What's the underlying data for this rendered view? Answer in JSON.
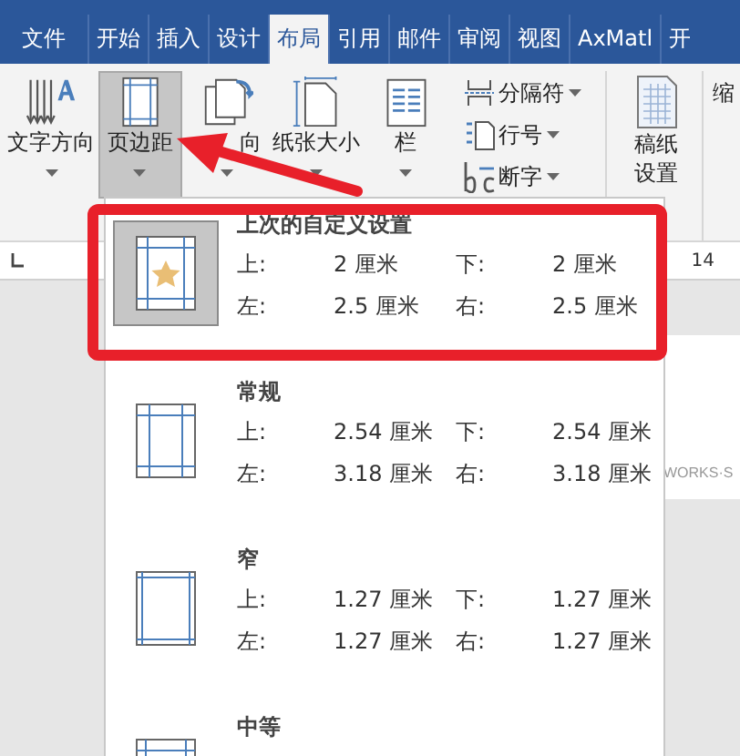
{
  "tabs": [
    {
      "label": "文件",
      "selected": false
    },
    {
      "label": "开始",
      "selected": false
    },
    {
      "label": "插入",
      "selected": false
    },
    {
      "label": "设计",
      "selected": false
    },
    {
      "label": "布局",
      "selected": true
    },
    {
      "label": "引用",
      "selected": false
    },
    {
      "label": "邮件",
      "selected": false
    },
    {
      "label": "审阅",
      "selected": false
    },
    {
      "label": "视图",
      "selected": false
    },
    {
      "label": "AxMatl",
      "selected": false
    },
    {
      "label": "开",
      "selected": false
    }
  ],
  "ribbon": {
    "large_buttons": [
      {
        "kind": "text-direction",
        "label": "文字方向",
        "selected": false
      },
      {
        "kind": "margins",
        "label": "页边距",
        "selected": true
      },
      {
        "kind": "orientation",
        "label": "向",
        "selected": false
      },
      {
        "kind": "size",
        "label": "纸张大小",
        "selected": false
      },
      {
        "kind": "columns",
        "label": "栏",
        "selected": false
      }
    ],
    "small_buttons": [
      {
        "kind": "breaks",
        "label": "分隔符"
      },
      {
        "kind": "line-numbers",
        "label": "行号"
      },
      {
        "kind": "hyphenation",
        "label": "断字"
      }
    ],
    "draft_button": {
      "lines": [
        "稿纸",
        "设置"
      ]
    },
    "next_group_label": "缩"
  },
  "ruler": {
    "number": "14"
  },
  "document_text": "WORKS·S",
  "margins_menu": {
    "items": [
      {
        "kind": "custom",
        "title": "上次的自定义设置",
        "selected": true,
        "rows": [
          {
            "label": "上:",
            "value": "2 厘米",
            "label2": "下:",
            "value2": "2 厘米"
          },
          {
            "label": "左:",
            "value": "2.5 厘米",
            "label2": "右:",
            "value2": "2.5 厘米"
          }
        ]
      },
      {
        "kind": "normal",
        "title": "常规",
        "selected": false,
        "rows": [
          {
            "label": "上:",
            "value": "2.54 厘米",
            "label2": "下:",
            "value2": "2.54 厘米"
          },
          {
            "label": "左:",
            "value": "3.18 厘米",
            "label2": "右:",
            "value2": "3.18 厘米"
          }
        ]
      },
      {
        "kind": "narrow",
        "title": "窄",
        "selected": false,
        "rows": [
          {
            "label": "上:",
            "value": "1.27 厘米",
            "label2": "下:",
            "value2": "1.27 厘米"
          },
          {
            "label": "左:",
            "value": "1.27 厘米",
            "label2": "右:",
            "value2": "1.27 厘米"
          }
        ]
      },
      {
        "kind": "moderate",
        "title": "中等",
        "selected": false
      }
    ]
  }
}
